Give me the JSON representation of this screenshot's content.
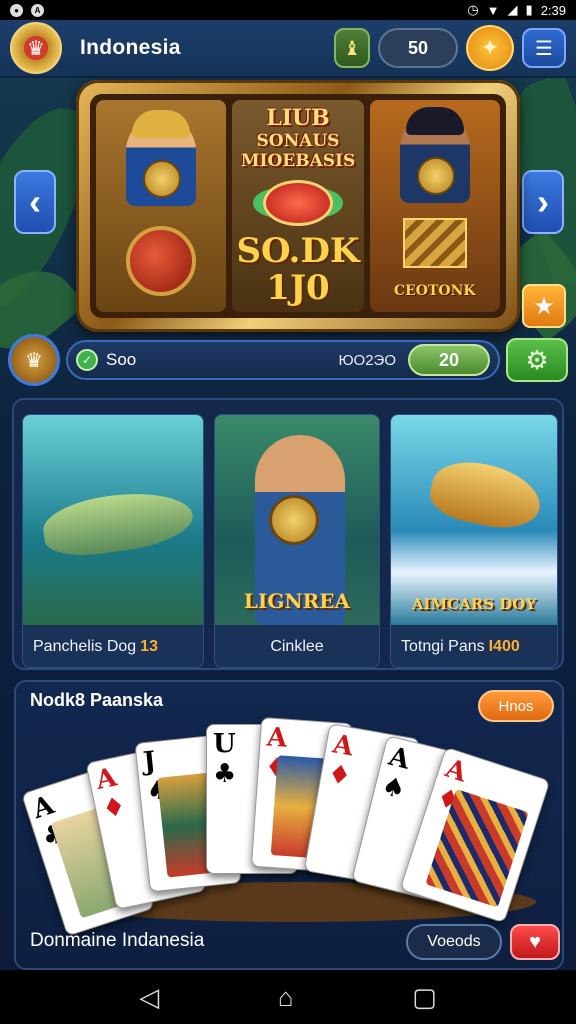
{
  "status_bar": {
    "time": "2:39",
    "battery": "",
    "left_icons": [
      "notification-icon",
      "app-icon"
    ]
  },
  "header": {
    "title": "Indonesia",
    "coin_value": "50"
  },
  "slot": {
    "reel1": {},
    "reel2": {
      "title_line1": "LIUB",
      "title_line2": "SONAUS",
      "title_line3": "MIOEBASIS",
      "amount": "SO.DK",
      "sub": "1J0"
    },
    "reel3": {
      "label": "CEOTONK"
    }
  },
  "info_bar": {
    "name": "Soo",
    "number": "ЮО2ЭО",
    "pill_value": "20"
  },
  "games": [
    {
      "label": "Panchelis Dog",
      "accent": "13",
      "banner": ""
    },
    {
      "label": "Cinklee",
      "accent": "",
      "banner": "LIGNREA"
    },
    {
      "label": "Totngi Pans",
      "accent": "I400",
      "banner": "AIMCARS DOY"
    }
  ],
  "card_panel": {
    "title": "Nodk8 Paanska",
    "pill_label": "Hnos",
    "bottom_label": "Donmaine Indanesia",
    "outline_button": "Voeods",
    "cards": [
      {
        "rank": "A",
        "suit": "♣",
        "red": false
      },
      {
        "rank": "A",
        "suit": "♦",
        "red": true
      },
      {
        "rank": "J",
        "suit": "♠",
        "red": false
      },
      {
        "rank": "U",
        "suit": "♣",
        "red": false
      },
      {
        "rank": "A",
        "suit": "♦",
        "red": true
      },
      {
        "rank": "A",
        "suit": "♦",
        "red": true
      },
      {
        "rank": "A",
        "suit": "♠",
        "red": false
      },
      {
        "rank": "A",
        "suit": "♦",
        "red": true
      }
    ]
  },
  "colors": {
    "accent_orange": "#ff9a3a",
    "accent_green": "#5ac04a",
    "accent_blue": "#3c78e0",
    "panel": "#13284a"
  }
}
